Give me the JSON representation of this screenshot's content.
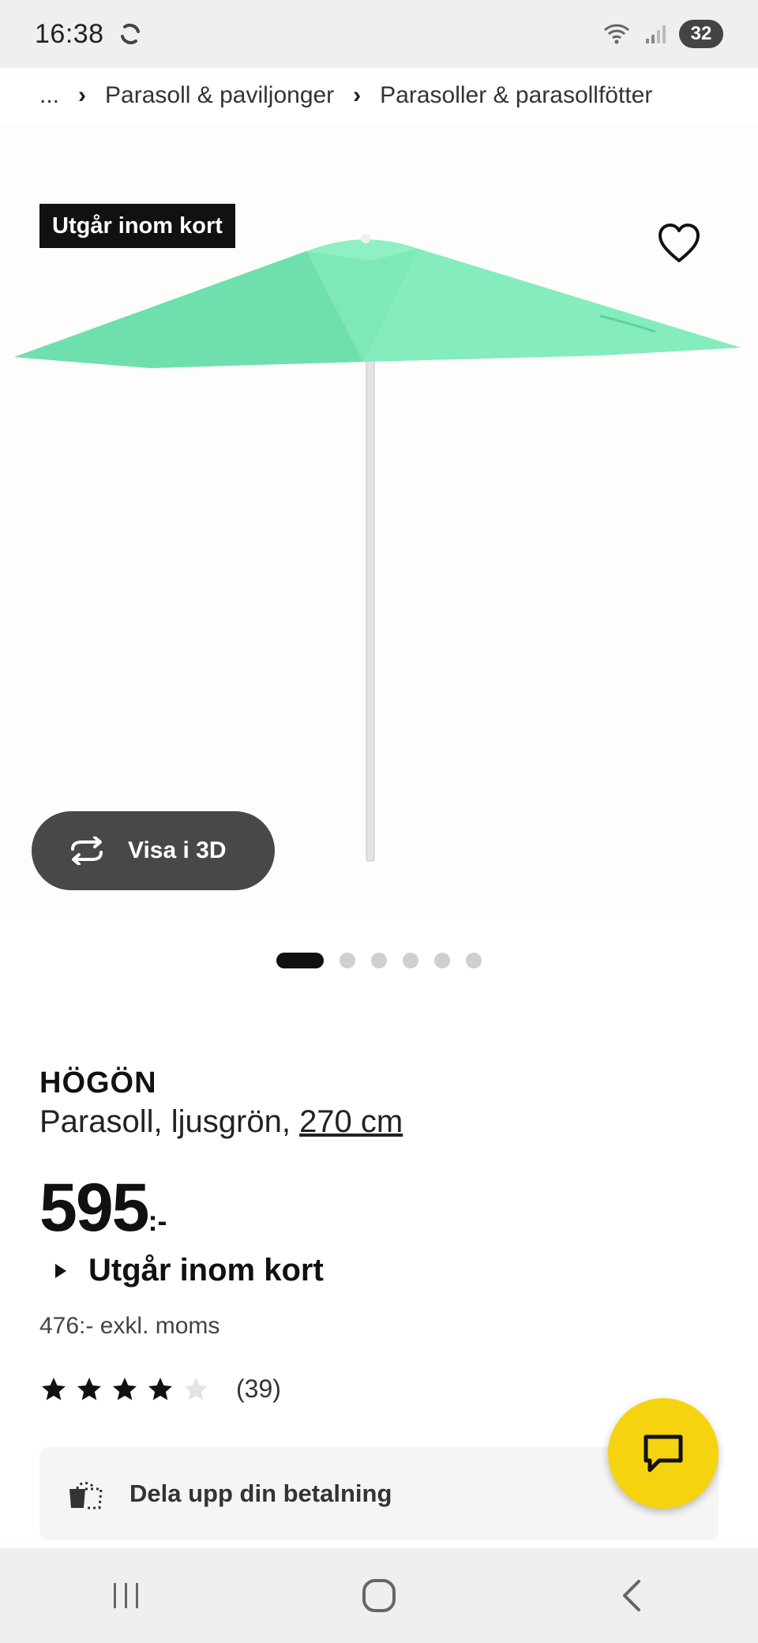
{
  "status_bar": {
    "time": "16:38",
    "battery": "32"
  },
  "breadcrumb": {
    "ellipsis": "...",
    "items": [
      "Parasoll & paviljonger",
      "Parasoller & parasollfötter"
    ]
  },
  "product": {
    "badge": "Utgår inom kort",
    "view_3d_label": "Visa i 3D",
    "image_count": 6,
    "active_image": 1,
    "brand": "HÖGÖN",
    "description": "Parasoll, ljusgrön,",
    "measure": "270 cm",
    "price": "595",
    "price_suffix": ":-",
    "availability": "Utgår inom kort",
    "price_excl_vat": "476:- exkl. moms",
    "rating": 4,
    "rating_max": 5,
    "rating_count": "(39)",
    "umbrella_color": "#7ee8b8"
  },
  "payment_banner": {
    "label": "Dela upp din betalning"
  },
  "colors": {
    "accent_yellow": "#f5d40f",
    "dark": "#111111"
  }
}
